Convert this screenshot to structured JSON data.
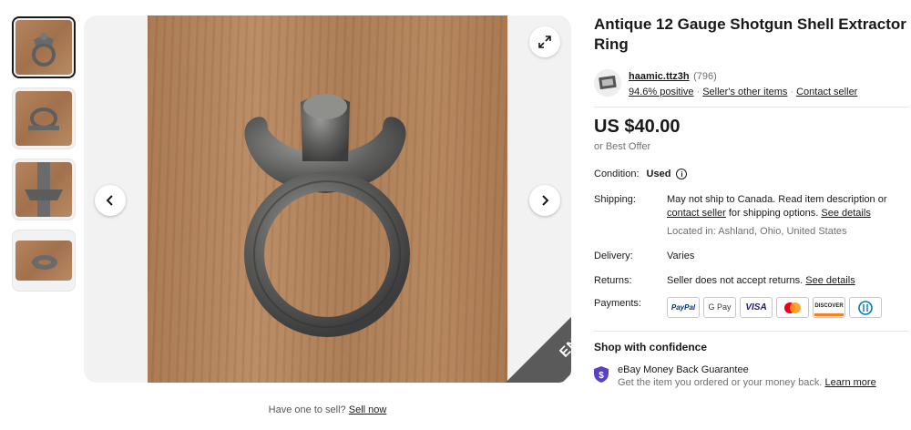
{
  "gallery": {
    "ended_label": "ENDED",
    "sell_prompt": "Have one to sell?",
    "sell_link": "Sell now"
  },
  "item": {
    "title": "Antique 12 Gauge Shotgun Shell Extractor Ring"
  },
  "seller": {
    "name": "haamic.ttz3h",
    "feedback_count": "(796)",
    "positive": "94.6% positive",
    "other_items": "Seller's other items",
    "contact": "Contact seller"
  },
  "price": {
    "amount": "US $40.00",
    "best_offer": "or Best Offer"
  },
  "condition": {
    "label": "Condition:",
    "value": "Used"
  },
  "shipping": {
    "label": "Shipping:",
    "text1": "May not ship to Canada. Read item description or",
    "contact_link": "contact seller",
    "text2": "for shipping options.",
    "details_link": "See details",
    "location": "Located in: Ashland, Ohio, United States"
  },
  "delivery": {
    "label": "Delivery:",
    "value": "Varies"
  },
  "returns": {
    "label": "Returns:",
    "value": "Seller does not accept returns.",
    "details_link": "See details"
  },
  "payments": {
    "label": "Payments:",
    "methods": [
      "PayPal",
      "G Pay",
      "VISA",
      "Mastercard",
      "DISCOVER",
      "Diners Club"
    ]
  },
  "confidence": {
    "heading": "Shop with confidence",
    "guarantee_title": "eBay Money Back Guarantee",
    "guarantee_text": "Get the item you ordered or your money back.",
    "learn_more": "Learn more"
  },
  "colors": {
    "ended_band": "#5a5a5a",
    "shield": "#5b3fc7",
    "paypal_blue": "#003087",
    "visa_blue": "#1a1f71",
    "discover_orange": "#f58220"
  }
}
